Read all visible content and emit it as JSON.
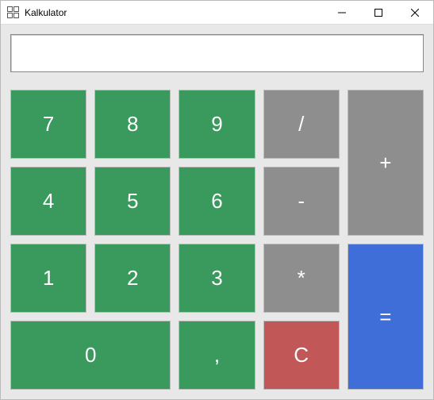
{
  "window": {
    "title": "Kalkulator"
  },
  "display": {
    "value": ""
  },
  "buttons": {
    "n7": "7",
    "n8": "8",
    "n9": "9",
    "divide": "/",
    "plus": "+",
    "n4": "4",
    "n5": "5",
    "n6": "6",
    "minus": "-",
    "n1": "1",
    "n2": "2",
    "n3": "3",
    "multiply": "*",
    "equals": "=",
    "n0": "0",
    "comma": ",",
    "clear": "C"
  },
  "colors": {
    "number_bg": "#3a9a5d",
    "operator_bg": "#8e8e8e",
    "clear_bg": "#c15757",
    "equals_bg": "#3f6ed9",
    "panel_bg": "#e8e8e8"
  }
}
